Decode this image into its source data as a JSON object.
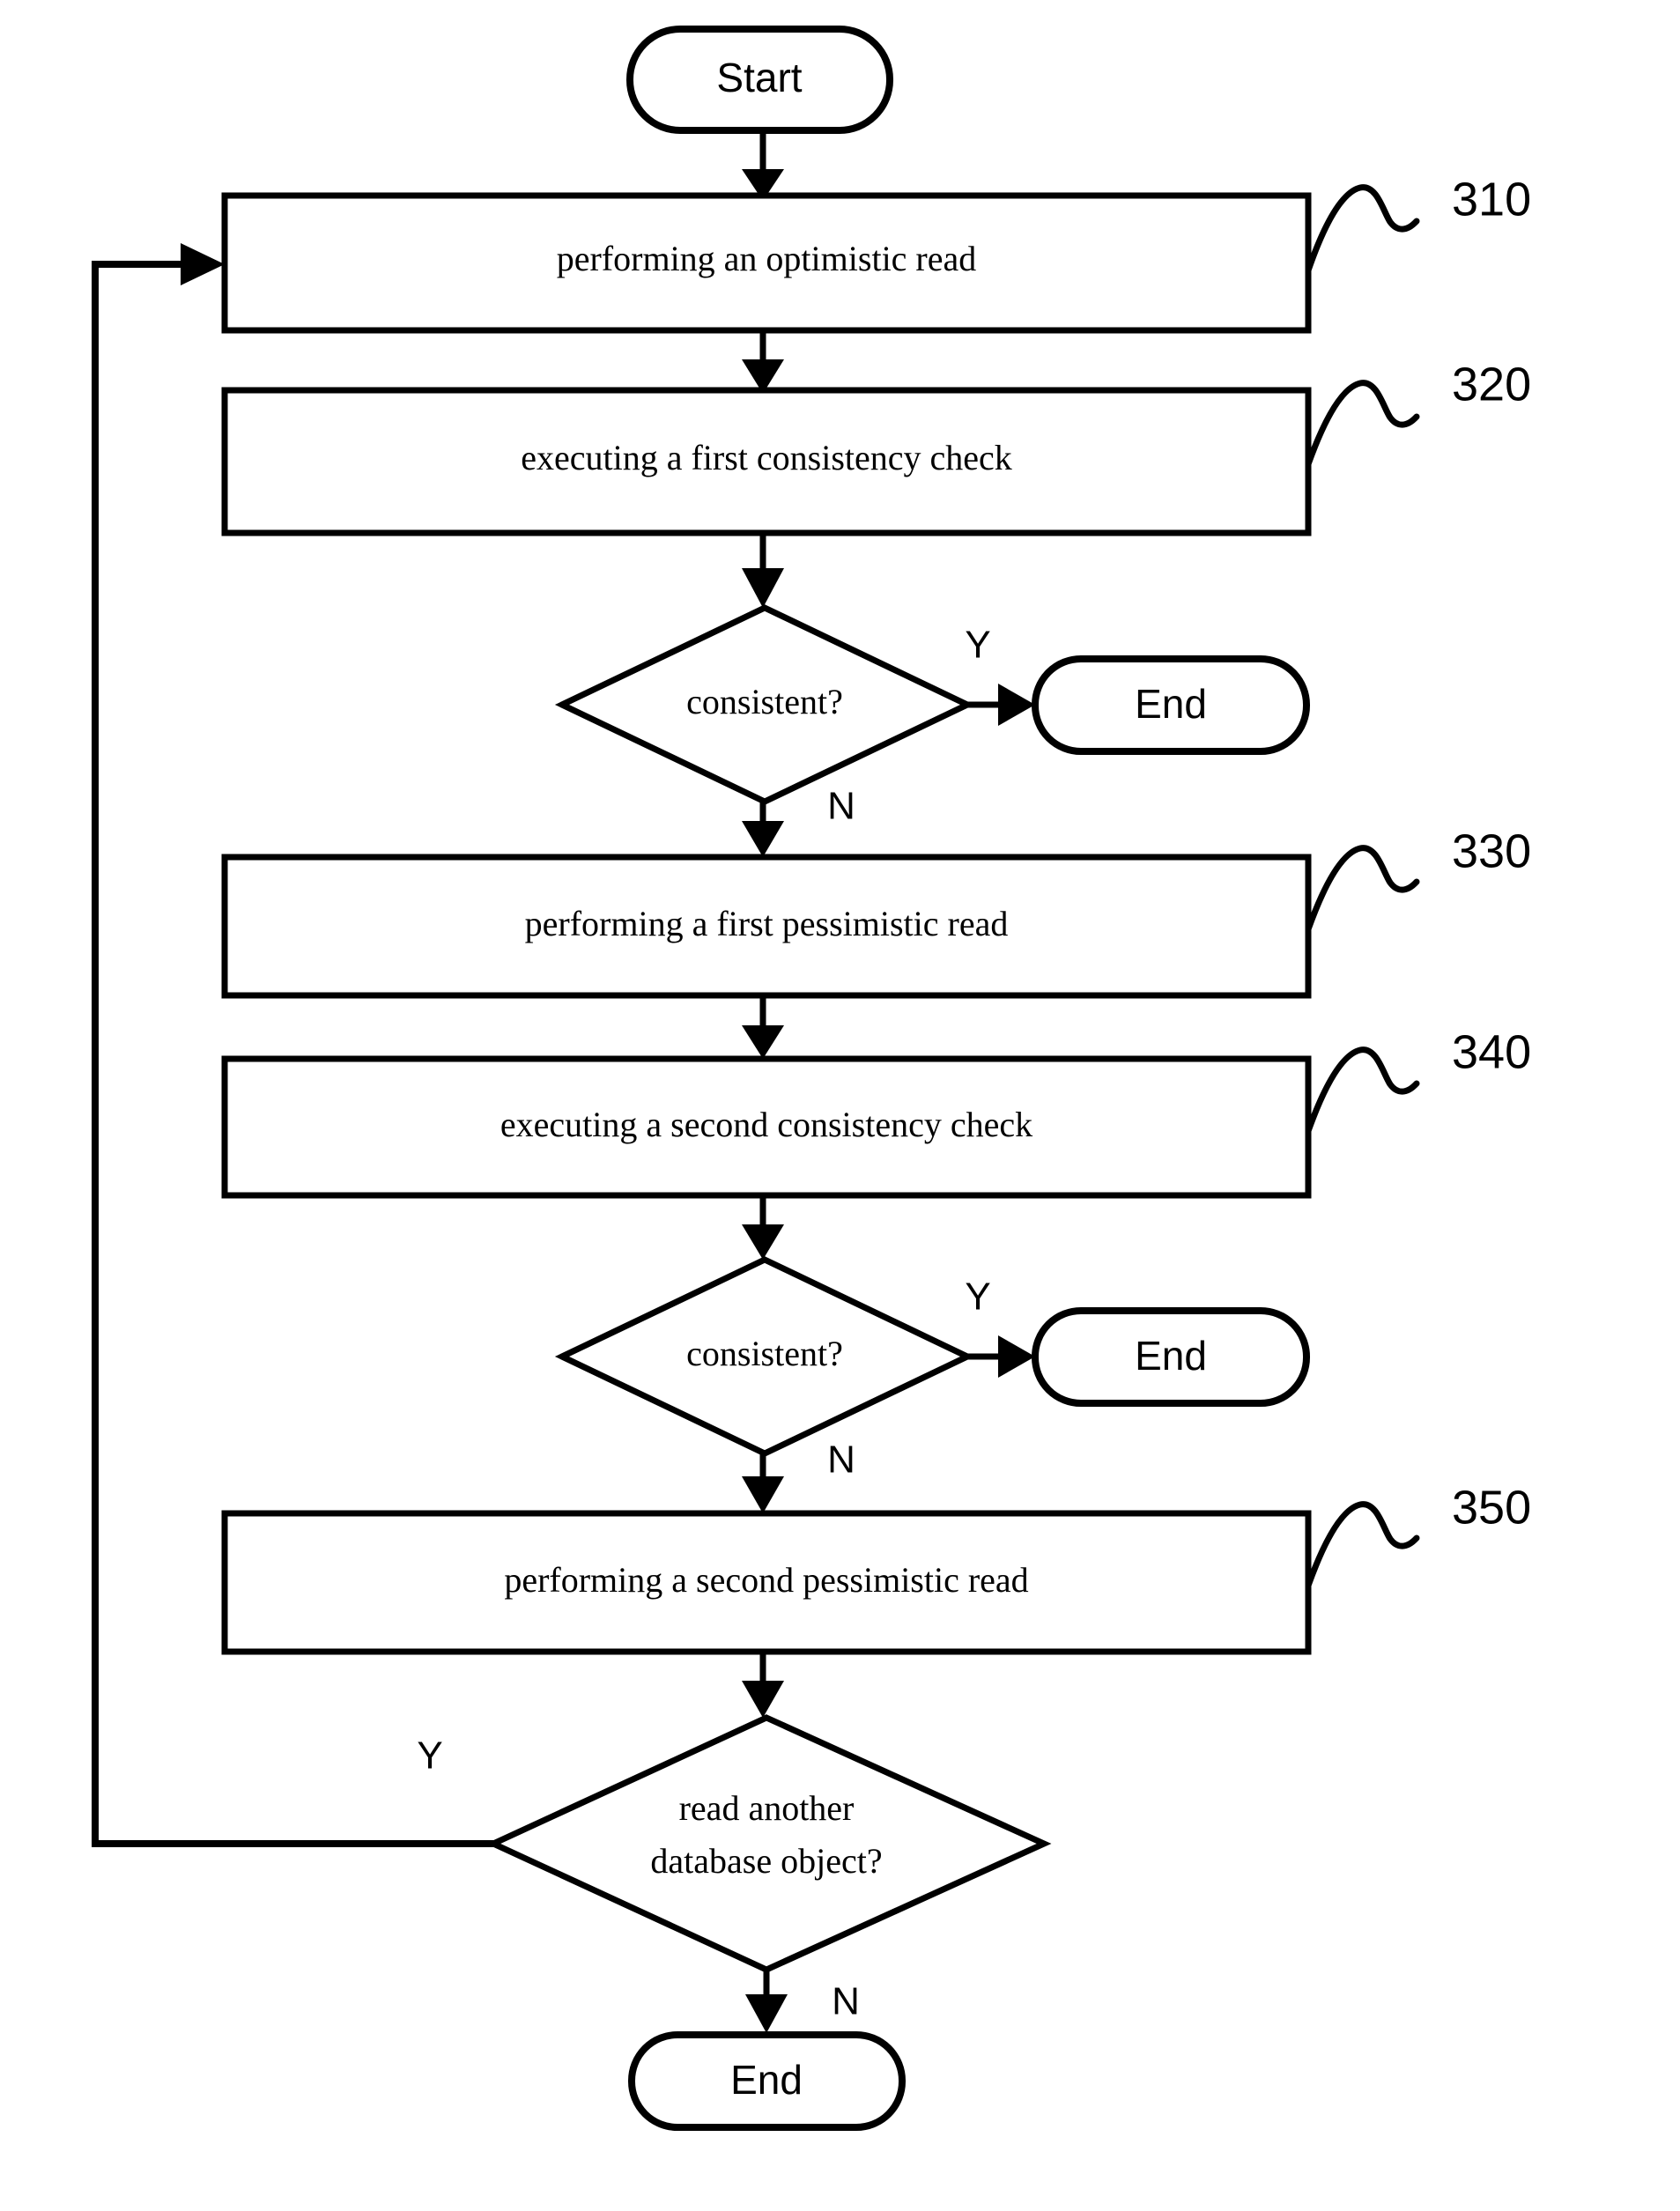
{
  "figure": {
    "type": "flowchart",
    "title": "",
    "background_color": "#ffffff",
    "line_color": "#000000"
  },
  "nodes": {
    "start": {
      "label": "Start",
      "shape": "terminator"
    },
    "step310": {
      "label": "performing an optimistic read",
      "shape": "process",
      "ref": "310"
    },
    "step320": {
      "label": "executing a first consistency check",
      "shape": "process",
      "ref": "320"
    },
    "decision1": {
      "label": "consistent?",
      "shape": "decision"
    },
    "end1": {
      "label": "End",
      "shape": "terminator"
    },
    "step330": {
      "label": "performing a first pessimistic read",
      "shape": "process",
      "ref": "330"
    },
    "step340": {
      "label": "executing a second consistency check",
      "shape": "process",
      "ref": "340"
    },
    "decision2": {
      "label": "consistent?",
      "shape": "decision"
    },
    "end2": {
      "label": "End",
      "shape": "terminator"
    },
    "step350": {
      "label": "performing a second pessimistic read",
      "shape": "process",
      "ref": "350"
    },
    "decision3": {
      "label_line1": "read another",
      "label_line2": "database object?",
      "shape": "decision"
    },
    "end3": {
      "label": "End",
      "shape": "terminator"
    }
  },
  "branch_labels": {
    "d1_yes": "Y",
    "d1_no": "N",
    "d2_yes": "Y",
    "d2_no": "N",
    "d3_yes": "Y",
    "d3_no": "N"
  },
  "ref_numerals": {
    "r310": "310",
    "r320": "320",
    "r330": "330",
    "r340": "340",
    "r350": "350"
  }
}
